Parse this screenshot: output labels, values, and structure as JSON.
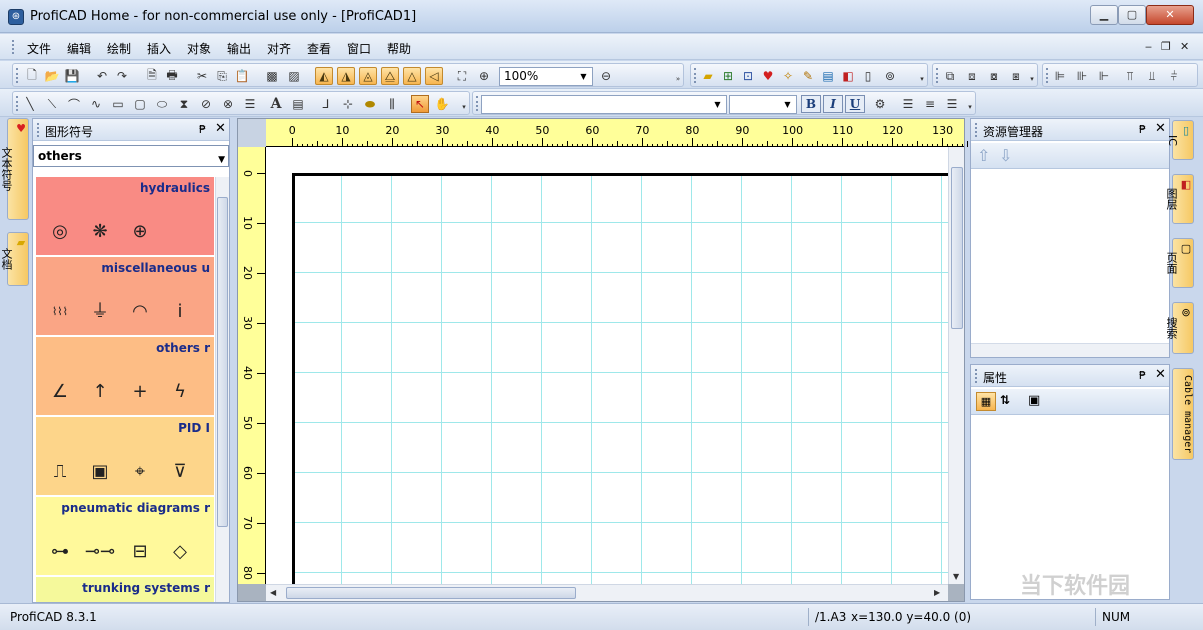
{
  "window": {
    "title": "ProfiCAD Home - for non-commercial use only - [ProfiCAD1]",
    "icon": "proficad-app-icon",
    "controls": {
      "minimize": "▁",
      "maximize": "▢",
      "close": "✕"
    }
  },
  "menubar": {
    "items": [
      "文件",
      "编辑",
      "绘制",
      "插入",
      "对象",
      "输出",
      "对齐",
      "查看",
      "窗口",
      "帮助"
    ],
    "mdi_controls": {
      "minimize": "‒",
      "restore": "❐",
      "close": "✕"
    }
  },
  "toolbar": {
    "zoom_value": "100%",
    "bold": "B",
    "italic": "I",
    "underline": "U",
    "text_tool": "A"
  },
  "left_tabs": [
    {
      "label": "文本符号",
      "icon": "symbol-tab-icon"
    },
    {
      "label": "文档",
      "icon": "folder-tab-icon"
    }
  ],
  "symbols_panel": {
    "title": "图形符号",
    "pin": "₱",
    "close": "✕",
    "category_select": "others",
    "categories": [
      {
        "name": "hydraulics",
        "color": "#f98b84",
        "icons": [
          "◎",
          "❋",
          "⊕"
        ]
      },
      {
        "name": "miscellaneous u",
        "color": "#faa585",
        "icons": [
          "⌇⌇⌇",
          "⏚",
          "◠",
          "ⅰ"
        ]
      },
      {
        "name": "others r",
        "color": "#fdbd85",
        "icons": [
          "∠",
          "↑",
          "+",
          "ϟ"
        ]
      },
      {
        "name": "PID I",
        "color": "#fdd58a",
        "icons": [
          "⎍",
          "▣",
          "⌖",
          "⊽"
        ]
      },
      {
        "name": "pneumatic diagrams r",
        "color": "#fff99b",
        "icons": [
          "⊶",
          "⊸⊸",
          "⊟",
          "◇"
        ]
      },
      {
        "name": "trunking systems r",
        "color": "#f5f99b",
        "icons": []
      }
    ]
  },
  "rulers": {
    "horizontal": [
      "0",
      "10",
      "20",
      "30",
      "40",
      "50",
      "60",
      "70",
      "80",
      "90",
      "100",
      "110",
      "120",
      "130"
    ],
    "vertical": [
      "0",
      "10",
      "20",
      "30",
      "40",
      "50",
      "60",
      "70",
      "80"
    ]
  },
  "resource_panel": {
    "title": "资源管理器",
    "pin": "₱",
    "close": "✕"
  },
  "properties_panel": {
    "title": "属性",
    "pin": "₱",
    "close": "✕"
  },
  "right_tabs": [
    {
      "label": "IC",
      "icon": "ic-tab-icon"
    },
    {
      "label": "图层",
      "icon": "layers-tab-icon"
    },
    {
      "label": "页面",
      "icon": "pages-tab-icon"
    },
    {
      "label": "搜索",
      "icon": "binoculars-tab-icon"
    },
    {
      "label": "Cable manager",
      "icon": ""
    }
  ],
  "statusbar": {
    "left": "ProfiCAD 8.3.1",
    "page": "/1.A3",
    "coords": "x=130.0  y=40.0 (0)",
    "num": "NUM"
  },
  "watermark": "当下软件园"
}
